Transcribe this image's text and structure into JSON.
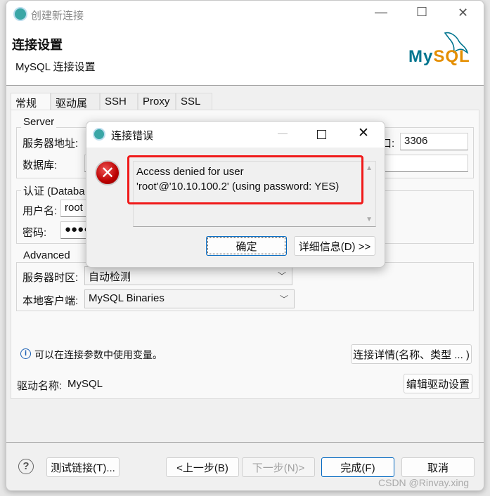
{
  "window": {
    "title": "创建新连接",
    "min": "—",
    "max": "☐",
    "close": "✕"
  },
  "header": {
    "title": "连接设置",
    "subtitle": "MySQL 连接设置",
    "logo": "MySQL"
  },
  "tabs": [
    {
      "label": "常规",
      "selected": true
    },
    {
      "label": "驱动属性"
    },
    {
      "label": "SSH"
    },
    {
      "label": "Proxy"
    },
    {
      "label": "SSL"
    }
  ],
  "server": {
    "group": "Server",
    "host_label": "服务器地址:",
    "port_label": "口:",
    "port_value": "3306",
    "db_label": "数据库:",
    "db_value": ""
  },
  "auth": {
    "group": "认证 (Databa",
    "user_label": "用户名:",
    "user_value": "root",
    "pass_label": "密码:",
    "pass_value": "●●●●"
  },
  "advanced": {
    "group": "Advanced",
    "tz_label": "服务器时区:",
    "tz_value": "自动检测",
    "client_label": "本地客户端:",
    "client_value": "MySQL Binaries"
  },
  "info": {
    "text": "可以在连接参数中使用变量。",
    "details_button": "连接详情(名称、类型 ... )"
  },
  "driver": {
    "label": "驱动名称:",
    "value": "MySQL",
    "edit_button": "编辑驱动设置"
  },
  "footer": {
    "test": "测试链接(T)...",
    "back": "<上一步(B)",
    "next": "下一步(N)>",
    "finish": "完成(F)",
    "cancel": "取消"
  },
  "error_dialog": {
    "title": "连接错误",
    "line1": "Access denied for user",
    "line2": "'root'@'10.10.100.2' (using password: YES)",
    "ok": "确定",
    "details": "详细信息(D) >>"
  },
  "watermark": "CSDN @Rinvay.xing",
  "colors": {
    "accent": "#0067c0",
    "highlight": "#f01a1a",
    "mysql_teal": "#00758f",
    "mysql_orange": "#e48e00"
  }
}
